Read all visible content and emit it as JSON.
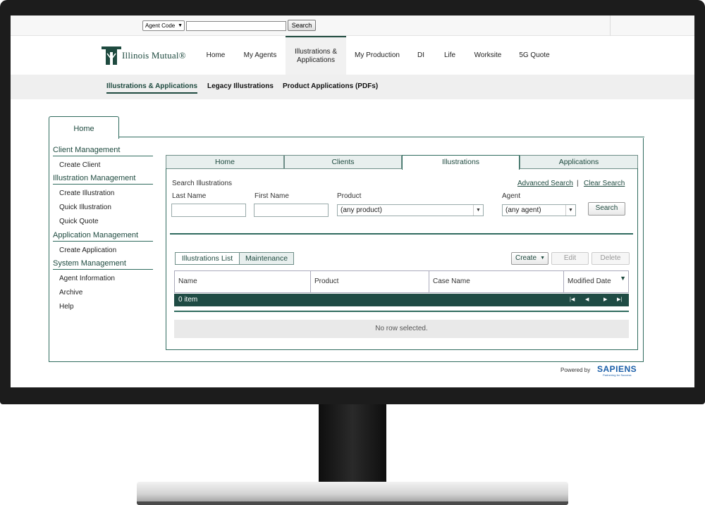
{
  "top_search": {
    "agent_select": "Agent Code",
    "search_button": "Search"
  },
  "brand": {
    "logo_text": "Illinois Mutual®",
    "accent_color": "#1e4a3f"
  },
  "nav": {
    "items": [
      {
        "label": "Home"
      },
      {
        "label": "My Agents"
      },
      {
        "label": "Illustrations & Applications"
      },
      {
        "label": "My Production"
      },
      {
        "label": "DI"
      },
      {
        "label": "Life"
      },
      {
        "label": "Worksite"
      },
      {
        "label": "5G Quote"
      }
    ]
  },
  "subnav": {
    "items": [
      {
        "label": "Illustrations & Applications"
      },
      {
        "label": "Legacy Illustrations"
      },
      {
        "label": "Product Applications (PDFs)"
      }
    ]
  },
  "main_tab": "Home",
  "sidebar": {
    "client_management": "Client Management",
    "create_client": "Create Client",
    "illustration_management": "Illustration Management",
    "create_illustration": "Create Illustration",
    "quick_illustration": "Quick Illustration",
    "quick_quote": "Quick Quote",
    "application_management": "Application Management",
    "create_application": "Create Application",
    "system_management": "System Management",
    "agent_information": "Agent Information",
    "archive": "Archive",
    "help": "Help"
  },
  "inner_tabs": [
    {
      "label": "Home"
    },
    {
      "label": "Clients"
    },
    {
      "label": "Illustrations"
    },
    {
      "label": "Applications"
    }
  ],
  "search_form": {
    "heading": "Search Illustrations",
    "advanced_search": "Advanced Search",
    "separator": "|",
    "clear_search": "Clear Search",
    "last_name_label": "Last Name",
    "first_name_label": "First Name",
    "product_label": "Product",
    "product_value": "(any product)",
    "agent_label": "Agent",
    "agent_value": "(any agent)",
    "search_button": "Search"
  },
  "list": {
    "view_list": "Illustrations List",
    "view_maintenance": "Maintenance",
    "create_button": "Create",
    "edit_button": "Edit",
    "delete_button": "Delete",
    "columns": [
      "Name",
      "Product",
      "Case Name",
      "Modified Date"
    ],
    "count": "0 item",
    "empty_message": "No row selected."
  },
  "footer": {
    "powered_by": "Powered by",
    "brand": "SAPIENS",
    "tagline": "Partnering for Success"
  }
}
